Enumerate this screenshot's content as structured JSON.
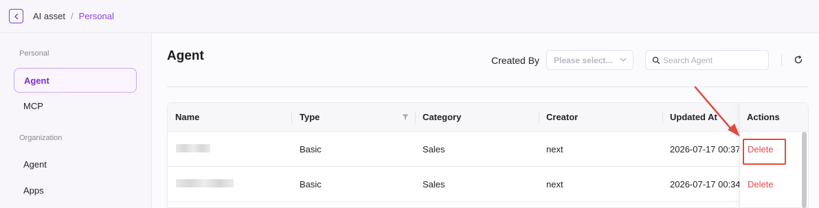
{
  "breadcrumb": {
    "home": "AI asset",
    "separator": "/",
    "current": "Personal"
  },
  "sidebar": {
    "personal_section": "Personal",
    "personal_items": [
      {
        "label": "Agent",
        "active": true
      },
      {
        "label": "MCP",
        "active": false
      }
    ],
    "organization_section": "Organization",
    "organization_items": [
      {
        "label": "Agent"
      },
      {
        "label": "Apps"
      }
    ]
  },
  "page": {
    "title": "Agent"
  },
  "filters": {
    "created_by_label": "Created By",
    "created_by_placeholder": "Please select...",
    "search_placeholder": "Search Agent"
  },
  "table": {
    "columns": [
      "Name",
      "Type",
      "Category",
      "Creator",
      "Updated At",
      "Actions"
    ],
    "rows": [
      {
        "name": "",
        "type": "Basic",
        "category": "Sales",
        "creator": "next",
        "updated_at": "2026-07-17 00:37:",
        "action": "Delete"
      },
      {
        "name": "",
        "type": "Basic",
        "category": "Sales",
        "creator": "next",
        "updated_at": "2026-07-17 00:34:",
        "action": "Delete"
      }
    ]
  },
  "colors": {
    "accent": "#8e3fdc",
    "danger": "#e5484d",
    "annotation": "#e24a3b"
  }
}
